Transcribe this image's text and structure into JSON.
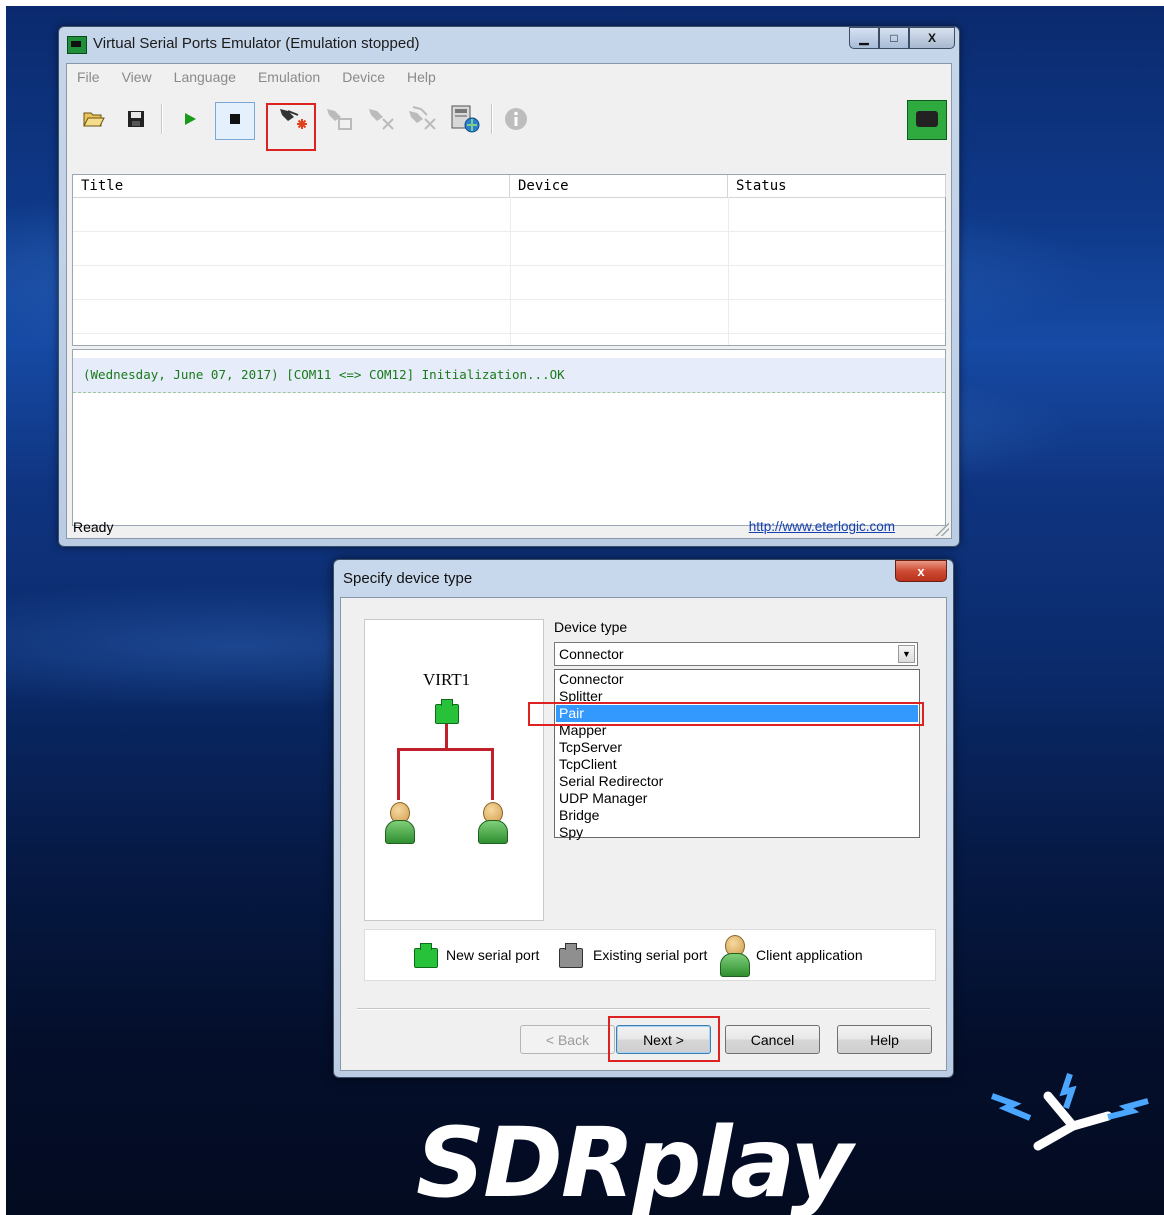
{
  "main_window": {
    "title": "Virtual Serial Ports Emulator (Emulation stopped)",
    "caption_buttons": {
      "minimize": "▁",
      "maximize": "□",
      "close": "X"
    },
    "menu": [
      "File",
      "View",
      "Language",
      "Emulation",
      "Device",
      "Help"
    ],
    "toolbar": {
      "icons": [
        "open-icon",
        "save-icon",
        "play-icon",
        "stop-icon",
        "new-device-icon",
        "device-properties-icon",
        "delete-device-icon",
        "delete-all-devices-icon",
        "network-settings-icon",
        "about-icon",
        "network-status-icon"
      ]
    },
    "table": {
      "columns": [
        "Title",
        "Device",
        "Status"
      ],
      "rows": []
    },
    "log": [
      "(Wednesday, June 07, 2017) [COM11 <=> COM12] Initialization...OK"
    ],
    "status": {
      "text": "Ready",
      "link": "http://www.eterlogic.com"
    }
  },
  "dialog": {
    "title": "Specify device type",
    "close_label": "x",
    "preview_label": "VIRT1",
    "device_type_label": "Device type",
    "selected_value": "Connector",
    "options": [
      "Connector",
      "Splitter",
      "Pair",
      "Mapper",
      "TcpServer",
      "TcpClient",
      "Serial Redirector",
      "UDP Manager",
      "Bridge",
      "Spy"
    ],
    "highlighted_option": "Pair",
    "legend": [
      "New serial port",
      "Existing serial port",
      "Client application"
    ],
    "buttons": {
      "back": "< Back",
      "next": "Next >",
      "cancel": "Cancel",
      "help": "Help"
    }
  },
  "branding": {
    "logo_text": "SDRplay"
  },
  "colors": {
    "highlight_red": "#d22222",
    "selection_blue": "#3399ff",
    "log_green": "#1a7a1a"
  }
}
